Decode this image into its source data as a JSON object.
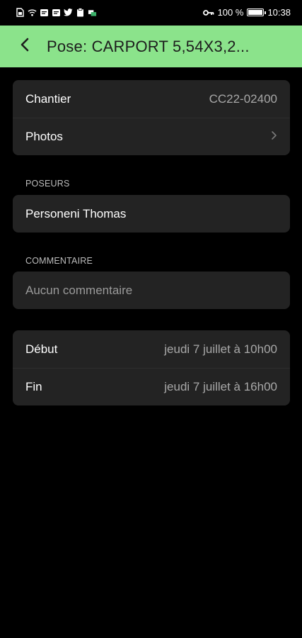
{
  "status_bar": {
    "icons_left": [
      "sim-icon",
      "wifi-icon",
      "message-icon",
      "message-icon",
      "twitter-icon",
      "clipboard-icon",
      "app-icon"
    ],
    "key_icon": "key-icon",
    "battery_text": "100 %",
    "battery_level": 1.0,
    "time": "10:38"
  },
  "header": {
    "bg_color": "#8be38b",
    "back_icon": "chevron-left-icon",
    "title": "Pose: CARPORT 5,54X3,2..."
  },
  "card_main": {
    "chantier_label": "Chantier",
    "chantier_value": "CC22-02400",
    "photos_label": "Photos",
    "photos_icon": "chevron-right-icon"
  },
  "poseurs": {
    "section_title": "POSEURS",
    "name": "Personeni Thomas"
  },
  "commentaire": {
    "section_title": "COMMENTAIRE",
    "placeholder": "Aucun commentaire"
  },
  "schedule": {
    "debut_label": "Début",
    "debut_value": "jeudi 7 juillet à 10h00",
    "fin_label": "Fin",
    "fin_value": "jeudi 7 juillet à 16h00"
  }
}
